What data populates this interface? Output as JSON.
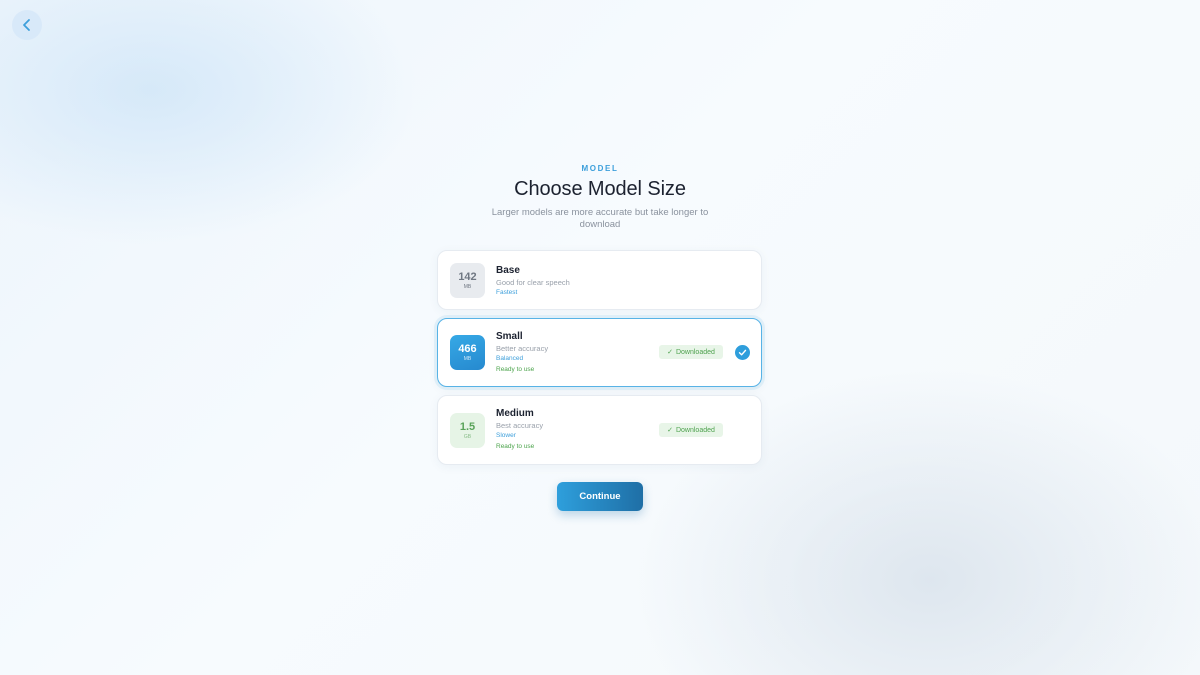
{
  "header": {
    "eyebrow": "MODEL",
    "title": "Choose Model Size",
    "subtitle": "Larger models are more accurate but take longer to download"
  },
  "models": [
    {
      "size": "142",
      "unit": "MB",
      "name": "Base",
      "description": "Good for clear speech",
      "speed": "Fastest",
      "status": "",
      "badge": "",
      "selected": false
    },
    {
      "size": "466",
      "unit": "MB",
      "name": "Small",
      "description": "Better accuracy",
      "speed": "Balanced",
      "status": "Ready to use",
      "badge": "Downloaded",
      "selected": true
    },
    {
      "size": "1.5",
      "unit": "GB",
      "name": "Medium",
      "description": "Best accuracy",
      "speed": "Slower",
      "status": "Ready to use",
      "badge": "Downloaded",
      "selected": false
    }
  ],
  "continue_label": "Continue",
  "icons": {
    "back": "chevron-left-icon",
    "badge_check": "✓",
    "selected": "check-circle-icon"
  },
  "colors": {
    "accent": "#2e9edc",
    "success": "#4fa24f",
    "title": "#1c2230"
  }
}
